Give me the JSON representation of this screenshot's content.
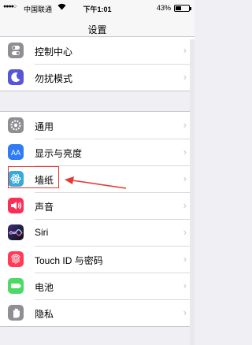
{
  "status_bar": {
    "signal": "●●●●○",
    "carrier": "中国联通",
    "wifi": "wifi-icon",
    "time": "下午1:01",
    "battery_text": "43%",
    "battery_level": 0.43
  },
  "nav": {
    "title": "设置"
  },
  "groups": [
    {
      "items": [
        {
          "label": "控制中心",
          "icon": "control-center-icon",
          "color": "#8e8e93"
        },
        {
          "label": "勿扰模式",
          "icon": "moon-icon",
          "color": "#5856d6"
        }
      ]
    },
    {
      "items": [
        {
          "label": "通用",
          "icon": "gear-icon",
          "color": "#8e8e93"
        },
        {
          "label": "显示与亮度",
          "icon": "display-brightness-icon",
          "color": "#2f7cf6"
        },
        {
          "label": "墙纸",
          "icon": "wallpaper-icon",
          "color": "#35aadc"
        },
        {
          "label": "声音",
          "icon": "speaker-icon",
          "color": "#ff2d55"
        },
        {
          "label": "Siri",
          "icon": "siri-icon",
          "color": "#1c1c3a"
        },
        {
          "label": "Touch ID 与密码",
          "icon": "fingerprint-icon",
          "color": "#ff3b58"
        },
        {
          "label": "电池",
          "icon": "battery-icon",
          "color": "#4cd964"
        },
        {
          "label": "隐私",
          "icon": "hand-icon",
          "color": "#8e8e93"
        }
      ]
    }
  ],
  "annotation": {
    "color": "#e53935"
  }
}
